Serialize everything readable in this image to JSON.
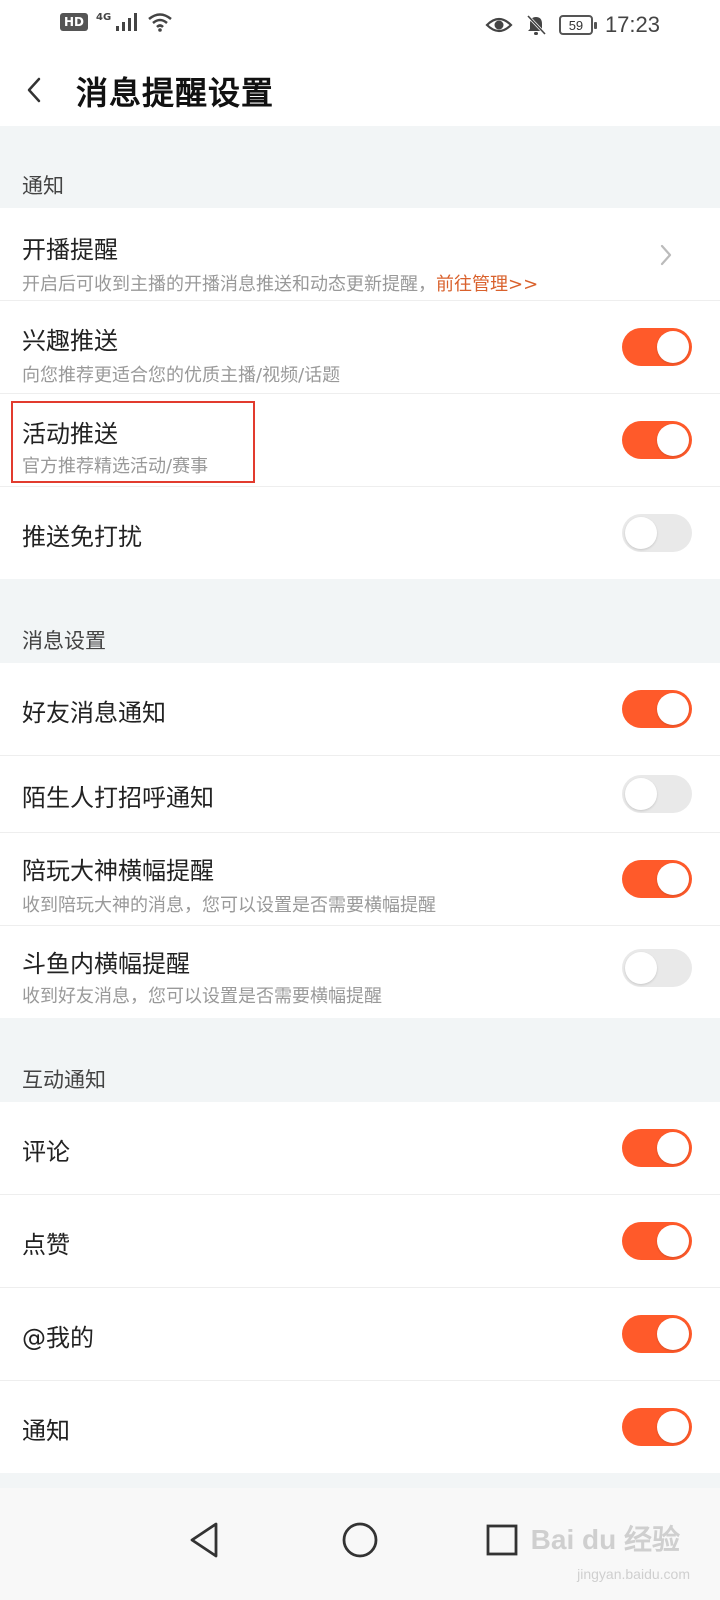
{
  "status_bar": {
    "hd_label": "HD",
    "network_label": "4G",
    "battery_level": "59",
    "time": "17:23"
  },
  "header": {
    "title": "消息提醒设置"
  },
  "sections": {
    "notify": {
      "title": "通知",
      "items": [
        {
          "title": "开播提醒",
          "subtitle": "开启后可收到主播的开播消息推送和动态更新提醒，",
          "link": "前往管理>>"
        },
        {
          "title": "兴趣推送",
          "subtitle": "向您推荐更适合您的优质主播/视频/话题",
          "on": true
        },
        {
          "title": "活动推送",
          "subtitle": "官方推荐精选活动/赛事",
          "on": true
        },
        {
          "title": "推送免打扰",
          "on": false
        }
      ]
    },
    "message": {
      "title": "消息设置",
      "items": [
        {
          "title": "好友消息通知",
          "on": true
        },
        {
          "title": "陌生人打招呼通知",
          "on": false
        },
        {
          "title": "陪玩大神横幅提醒",
          "subtitle": "收到陪玩大神的消息，您可以设置是否需要横幅提醒",
          "on": true
        },
        {
          "title": "斗鱼内横幅提醒",
          "subtitle": "收到好友消息，您可以设置是否需要横幅提醒",
          "on": false
        }
      ]
    },
    "interaction": {
      "title": "互动通知",
      "items": [
        {
          "title": "评论",
          "on": true
        },
        {
          "title": "点赞",
          "on": true
        },
        {
          "title": "@我的",
          "on": true
        },
        {
          "title": "通知",
          "on": true
        }
      ]
    }
  },
  "watermark": {
    "brand": "Bai du 经验",
    "url": "jingyan.baidu.com"
  },
  "colors": {
    "accent": "#ff5a2a",
    "link": "#d9612c",
    "highlight": "#e23b2e"
  }
}
